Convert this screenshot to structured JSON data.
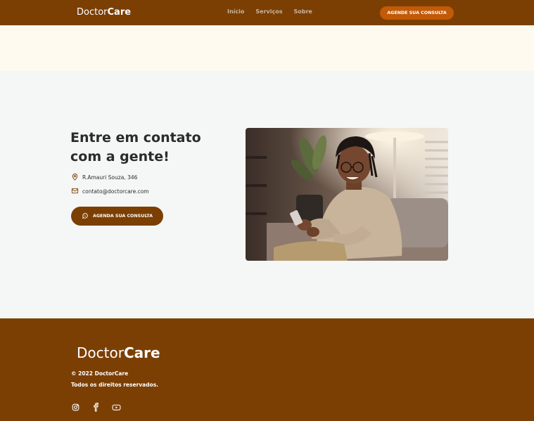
{
  "header": {
    "brand_regular": "Doctor",
    "brand_bold": "Care",
    "nav": [
      "Início",
      "Serviços",
      "Sobre"
    ],
    "cta_label": "AGENDE SUA CONSULTA"
  },
  "contact": {
    "title": "Entre em contato com a gente!",
    "address": "R.Amauri Souza, 346",
    "email": "contato@doctorcare.com",
    "button_label": "AGENDA SUA CONSULTA",
    "address_icon": "map-pin-icon",
    "email_icon": "mail-icon",
    "button_icon": "whatsapp-icon"
  },
  "footer": {
    "brand_regular": "Doctor",
    "brand_bold": "Care",
    "copyright": "© 2022 DoctorCare",
    "rights": "Todos os direitos reservados.",
    "social_icons": [
      "instagram-icon",
      "facebook-icon",
      "youtube-icon"
    ]
  },
  "colors": {
    "brand_brown": "#7b3f04",
    "accent_orange": "#c25a08",
    "hero_cream": "#fffaf0",
    "section_gray": "#f5f6f6",
    "text_dark": "#2b2b2b"
  }
}
